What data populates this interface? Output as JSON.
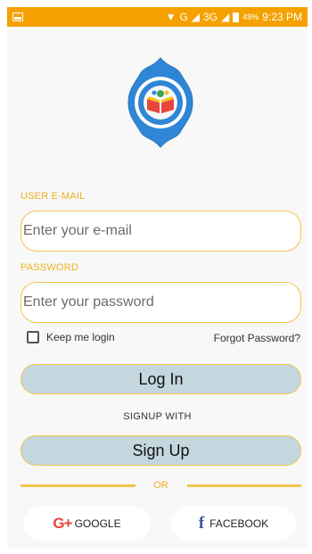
{
  "status_bar": {
    "network_g": "G",
    "network_3g": "3G",
    "battery": "49%",
    "time": "9:23 PM"
  },
  "logo": {
    "colors": {
      "outer": "#2f86d6",
      "ring": "#ffffff",
      "inner": "#f6f8fb",
      "book_red": "#e8453c",
      "book_yellow": "#f4c21f"
    }
  },
  "form": {
    "email_label": "USER E-MAIL",
    "email_placeholder": "Enter your e-mail",
    "password_label": "PASSWORD",
    "password_placeholder": "Enter your password",
    "keep_login_label": "Keep me login",
    "keep_login_checked": false,
    "forgot_password": "Forgot Password?",
    "login_button": "Log In",
    "signup_with": "SIGNUP WITH",
    "signup_button": "Sign Up",
    "or_text": "OR"
  },
  "social": {
    "google_prefix": "G+",
    "google_label": "GOOGLE",
    "facebook_prefix": "f",
    "facebook_label": "FACEBOOK"
  },
  "colors": {
    "status_bar": "#f5a100",
    "accent": "#f0c64a",
    "label": "#f0b020",
    "button_fill": "#c4d6de"
  }
}
